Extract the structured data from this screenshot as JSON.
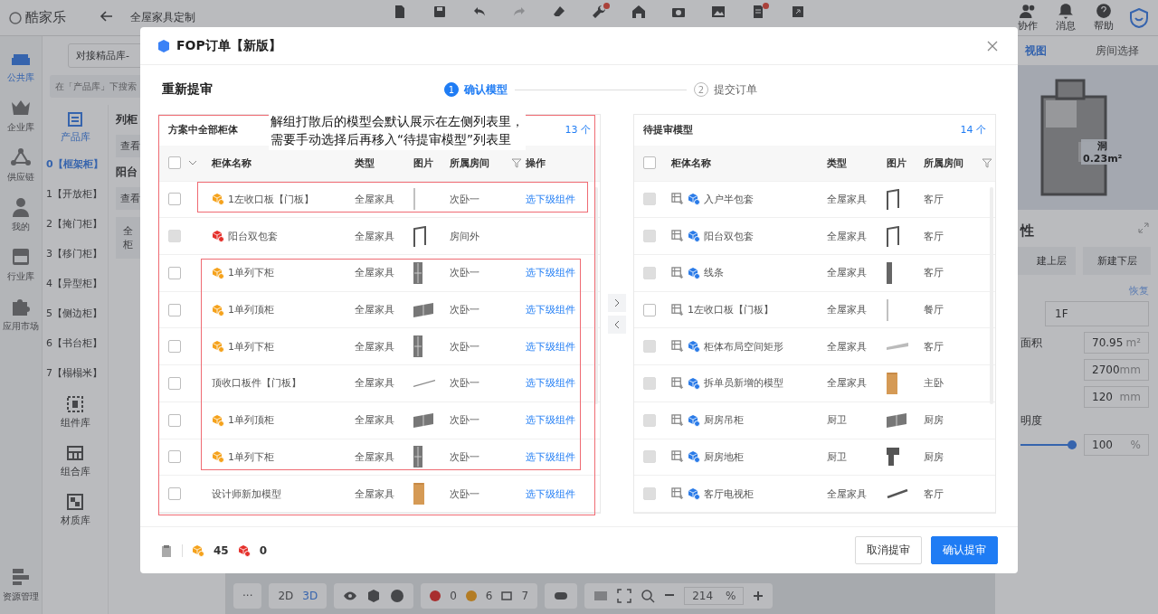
{
  "topbar": {
    "logo": "酷家乐",
    "project": "全屋家具定制",
    "tools": [
      {
        "kind": "file",
        "dot": false
      },
      {
        "kind": "save",
        "dot": false
      },
      {
        "kind": "undo",
        "dot": false
      },
      {
        "kind": "redo",
        "dot": false
      },
      {
        "kind": "eraser",
        "dot": false
      },
      {
        "kind": "wrench",
        "dot": true
      },
      {
        "kind": "house",
        "dot": false
      },
      {
        "kind": "camera",
        "dot": false
      },
      {
        "kind": "image",
        "dot": false
      },
      {
        "kind": "document",
        "dot": true
      },
      {
        "kind": "export",
        "dot": false
      }
    ],
    "actions": [
      {
        "kind": "people",
        "label": "协作"
      },
      {
        "kind": "bell",
        "label": "消息"
      },
      {
        "kind": "help",
        "label": "帮助"
      }
    ]
  },
  "rail": {
    "items": [
      {
        "kind": "sofa",
        "label": "公共库",
        "selected": true
      },
      {
        "kind": "crown",
        "label": "企业库",
        "selected": false
      },
      {
        "kind": "network",
        "label": "供应链",
        "selected": false
      },
      {
        "kind": "person",
        "label": "我的",
        "selected": false
      },
      {
        "kind": "drawer",
        "label": "行业库",
        "selected": false
      },
      {
        "kind": "puzzle",
        "label": "应用市场",
        "selected": false
      }
    ],
    "bottom": "资源管理"
  },
  "library": {
    "source": "对接精品库-",
    "search": {
      "placeholder": "在「产品库」下搜索"
    },
    "tab": "产品库",
    "categories": [
      {
        "label": "0【框架柜】",
        "selected": true
      },
      {
        "label": "1【开放柜】",
        "selected": false
      },
      {
        "label": "2【掩门柜】",
        "selected": false
      },
      {
        "label": "3【移门柜】",
        "selected": false
      },
      {
        "label": "4【异型柜】",
        "selected": false
      },
      {
        "label": "5【侧边柜】",
        "selected": false
      },
      {
        "label": "6【书台柜】",
        "selected": false
      },
      {
        "label": "7【榻榻米】",
        "selected": false
      }
    ],
    "more": [
      {
        "kind": "component",
        "label": "组件库"
      },
      {
        "kind": "combo",
        "label": "组合库"
      },
      {
        "kind": "material",
        "label": "材质库"
      }
    ],
    "sections": [
      {
        "title": "列柜",
        "button": "查看"
      },
      {
        "title": "阳台",
        "button": "查看"
      }
    ],
    "card_lines": [
      "全",
      "柜"
    ]
  },
  "right_panel": {
    "tabs": [
      {
        "label": "视图",
        "selected": true
      },
      {
        "label": "房间选择",
        "selected": false
      }
    ],
    "plan_labels": [
      "洞",
      "0.23m²"
    ],
    "heading": "性",
    "layer_buttons": [
      "建上层",
      "新建下层"
    ],
    "restore": "恢复",
    "floor": "1F",
    "fields": [
      {
        "label": "面积",
        "value": "70.95",
        "unit": "m²"
      },
      {
        "value": "2700",
        "unit": "mm"
      },
      {
        "value": "120",
        "unit": "mm"
      }
    ],
    "opacity": {
      "label": "明度",
      "level": 1,
      "value": "100",
      "unit": "%"
    }
  },
  "bottom_toolbar": {
    "more": "···",
    "modes": [
      {
        "label": "2D",
        "selected": false
      },
      {
        "label": "3D",
        "selected": true
      }
    ],
    "errors": "0",
    "warnings": "6",
    "layers": "7",
    "zoom": "214",
    "zoom_unit": "%"
  },
  "modal": {
    "title": "FOP订单【新版】",
    "subtitle": "重新提审",
    "steps": [
      {
        "number": "1",
        "label": "确认模型",
        "selected": true
      },
      {
        "number": "2",
        "label": "提交订单",
        "selected": false
      }
    ],
    "left": {
      "title": "方案中全部柜体",
      "count": "13 个",
      "select_all": {
        "checked": false
      },
      "columns": [
        "柜体名称",
        "类型",
        "图片",
        "所属房间",
        "操作"
      ],
      "rows": [
        {
          "color": "#f5a21c",
          "name": "1左收口板【门板】",
          "type": "全屋家具",
          "picture": {
            "kind": "line-vertical"
          },
          "room": "次卧一",
          "action": "选下级组件",
          "disabled": false
        },
        {
          "color": "#e5302b",
          "name": "阳台双包套",
          "type": "全屋家具",
          "picture": {
            "kind": "frame"
          },
          "room": "房间外",
          "disabled": true
        },
        {
          "color": "#f5a21c",
          "name": "1单列下柜",
          "type": "全屋家具",
          "picture": {
            "kind": "tall"
          },
          "room": "次卧一",
          "action": "选下级组件",
          "disabled": false
        },
        {
          "color": "#f5a21c",
          "name": "1单列顶柜",
          "type": "全屋家具",
          "picture": {
            "kind": "wide"
          },
          "room": "次卧一",
          "action": "选下级组件",
          "disabled": false
        },
        {
          "color": "#f5a21c",
          "name": "1单列下柜",
          "type": "全屋家具",
          "picture": {
            "kind": "tall"
          },
          "room": "次卧一",
          "action": "选下级组件",
          "disabled": false
        },
        {
          "name": "顶收口板件【门板】",
          "type": "全屋家具",
          "picture": {
            "kind": "line-diagonal"
          },
          "room": "次卧一",
          "action": "选下级组件",
          "disabled": false
        },
        {
          "color": "#f5a21c",
          "name": "1单列顶柜",
          "type": "全屋家具",
          "picture": {
            "kind": "wide"
          },
          "room": "次卧一",
          "action": "选下级组件",
          "disabled": false
        },
        {
          "color": "#f5a21c",
          "name": "1单列下柜",
          "type": "全屋家具",
          "picture": {
            "kind": "tall"
          },
          "room": "次卧一",
          "action": "选下级组件",
          "disabled": false
        },
        {
          "name": "设计师新加模型",
          "type": "全屋家具",
          "picture": {
            "kind": "wood"
          },
          "room": "次卧一",
          "action": "选下级组件",
          "disabled": false
        }
      ]
    },
    "right": {
      "title": "待提审模型",
      "count": "14 个",
      "select_all": {
        "checked": false
      },
      "columns": [
        "柜体名称",
        "类型",
        "图片",
        "所属房间"
      ],
      "rows": [
        {
          "color": "#2a7be8",
          "name": "入户半包套",
          "type": "全屋家具",
          "picture": {
            "kind": "frame"
          },
          "room": "客厅",
          "disabled": true
        },
        {
          "color": "#2a7be8",
          "name": "阳台双包套",
          "type": "全屋家具",
          "picture": {
            "kind": "frame"
          },
          "room": "客厅",
          "disabled": true
        },
        {
          "color": "#2a7be8",
          "name": "线条",
          "type": "全屋家具",
          "picture": {
            "kind": "strip"
          },
          "room": "客厅",
          "disabled": true
        },
        {
          "name": "1左收口板【门板】",
          "type": "全屋家具",
          "picture": {
            "kind": "line-vertical"
          },
          "room": "餐厅",
          "disabled": false
        },
        {
          "color": "#2a7be8",
          "name": "柜体布局空间矩形",
          "type": "全屋家具",
          "picture": {
            "kind": "plank"
          },
          "room": "客厅",
          "disabled": true
        },
        {
          "color": "#2a7be8",
          "name": "拆单员新增的模型",
          "type": "全屋家具",
          "picture": {
            "kind": "wood"
          },
          "room": "主卧",
          "disabled": true
        },
        {
          "color": "#2a7be8",
          "name": "厨房吊柜",
          "type": "厨卫",
          "picture": {
            "kind": "wide"
          },
          "room": "厨房",
          "disabled": true
        },
        {
          "color": "#2a7be8",
          "name": "厨房地柜",
          "type": "厨卫",
          "picture": {
            "kind": "corner"
          },
          "room": "厨房",
          "disabled": true
        },
        {
          "color": "#2a7be8",
          "name": "客厅电视柜",
          "type": "全屋家具",
          "picture": {
            "kind": "bar"
          },
          "room": "客厅",
          "disabled": true
        }
      ]
    },
    "annotation": {
      "lines": [
        "解组打散后的模型会默认展示在左侧列表里，",
        "需要手动选择后再移入“待提审模型”列表里"
      ]
    },
    "footer": {
      "warnings": "45",
      "errors": "0",
      "buttons": [
        {
          "kind": "secondary",
          "label": "取消提审"
        },
        {
          "kind": "primary",
          "label": "确认提审"
        }
      ]
    }
  }
}
